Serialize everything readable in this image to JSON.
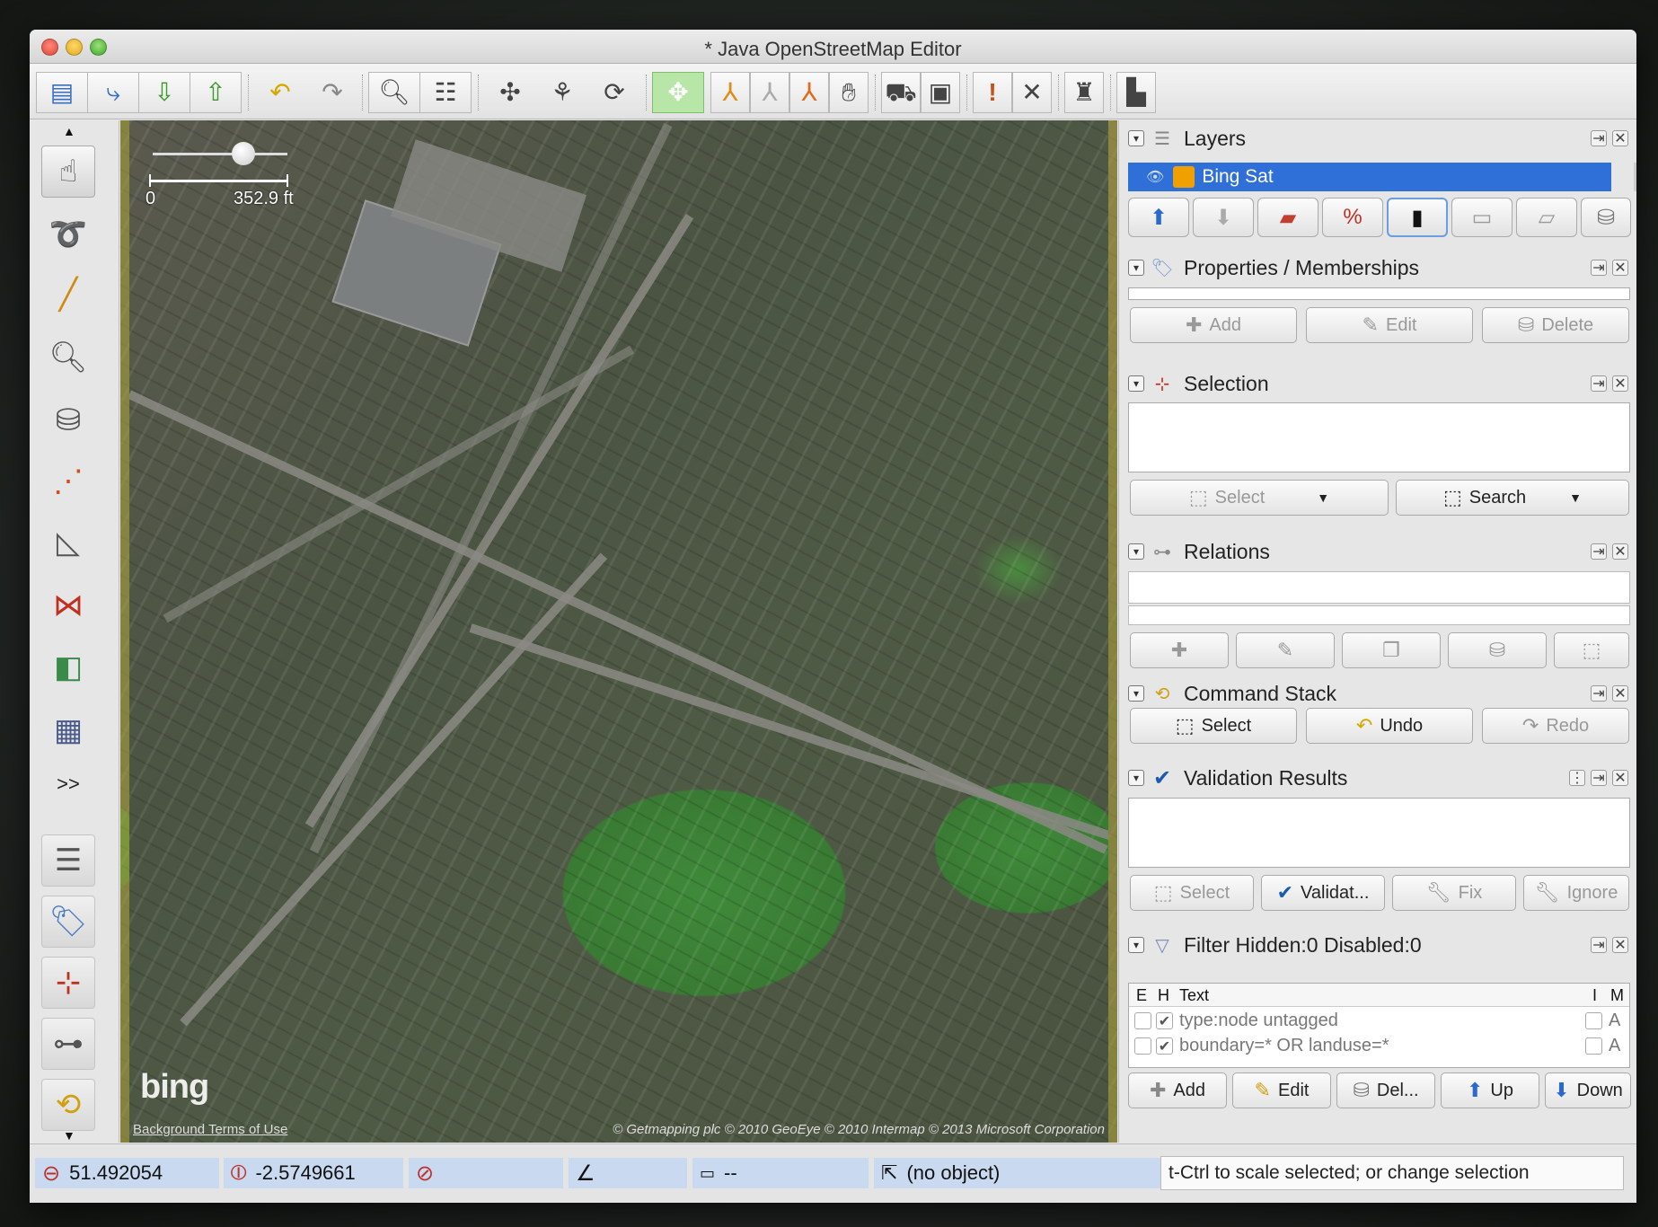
{
  "window": {
    "title": "* Java OpenStreetMap Editor"
  },
  "toolbar": {
    "buttons": [
      "open-icon",
      "save-icon",
      "download-icon",
      "upload-icon",
      "undo-icon",
      "redo-icon",
      "zoom-icon",
      "preferences-icon",
      "split-way-icon",
      "combine-way-icon",
      "reverse-icon",
      "wireframe-icon",
      "presets-a-icon",
      "presets-b-icon",
      "presets-c-icon",
      "hand-icon",
      "car-icon",
      "bus-icon",
      "warning-icon",
      "cross-icon",
      "industrial-a-icon",
      "industrial-b-icon"
    ]
  },
  "map": {
    "scale_start": "0",
    "scale_end": "352.9 ft",
    "logo": "bing",
    "attribution_left": "Background Terms of Use",
    "attribution_right": "© Getmapping plc © 2010 GeoEye © 2010 Intermap © 2013 Microsoft Corporation"
  },
  "layers": {
    "title": "Layers",
    "items": [
      {
        "name": "Bing Sat",
        "selected": true
      }
    ]
  },
  "properties": {
    "title": "Properties / Memberships",
    "add_label": "Add",
    "edit_label": "Edit",
    "delete_label": "Delete"
  },
  "selection": {
    "title": "Selection",
    "select_label": "Select",
    "search_label": "Search"
  },
  "relations": {
    "title": "Relations"
  },
  "command_stack": {
    "title": "Command Stack",
    "select_label": "Select",
    "undo_label": "Undo",
    "redo_label": "Redo"
  },
  "validation": {
    "title": "Validation Results",
    "select_label": "Select",
    "validate_label": "Validat...",
    "fix_label": "Fix",
    "ignore_label": "Ignore"
  },
  "filter": {
    "title": "Filter Hidden:0 Disabled:0",
    "columns": {
      "e": "E",
      "h": "H",
      "text": "Text",
      "i": "I",
      "m": "M"
    },
    "rows": [
      {
        "text": "type:node untagged",
        "m": "A"
      },
      {
        "text": "boundary=* OR landuse=*",
        "m": "A"
      }
    ],
    "add_label": "Add",
    "edit_label": "Edit",
    "delete_label": "Del...",
    "up_label": "Up",
    "down_label": "Down"
  },
  "status": {
    "lat": "51.492054",
    "lon": "-2.5749661",
    "distance": "--",
    "object": "(no object)",
    "help": "t-Ctrl to scale selected; or change selection"
  }
}
